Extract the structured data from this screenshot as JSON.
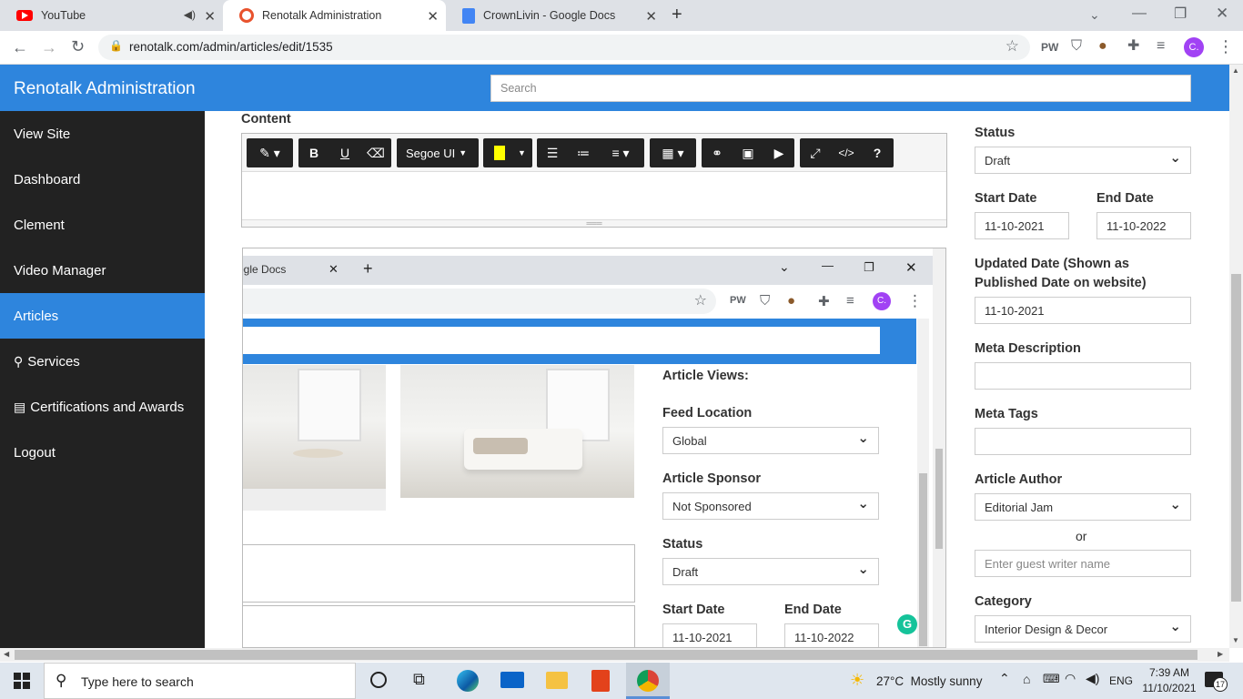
{
  "browser": {
    "tabs": [
      {
        "title": "YouTube",
        "color": "#ff0000"
      },
      {
        "title": "Renotalk Administration",
        "color": "#e8522d"
      },
      {
        "title": "CrownLivin - Google Docs",
        "color": "#4285f4"
      }
    ],
    "url": "renotalk.com/admin/articles/edit/1535"
  },
  "app": {
    "title": "Renotalk Administration",
    "search_placeholder": "Search",
    "accent": "#2e85dd"
  },
  "sidebar": {
    "items": [
      {
        "label": "View Site"
      },
      {
        "label": "Dashboard"
      },
      {
        "label": "Clement"
      },
      {
        "label": "Video Manager"
      },
      {
        "label": "Articles"
      },
      {
        "label": "Services"
      },
      {
        "label": "Certifications and Awards"
      },
      {
        "label": "Logout"
      }
    ]
  },
  "editor": {
    "content_label": "Content",
    "font": "Segoe UI"
  },
  "right": {
    "status_label": "Status",
    "status_value": "Draft",
    "start_date_label": "Start Date",
    "start_date_value": "11-10-2021",
    "end_date_label": "End Date",
    "end_date_value": "11-10-2022",
    "updated_label_1": "Updated Date (Shown as",
    "updated_label_2": "Published Date on website)",
    "updated_value": "11-10-2021",
    "meta_desc_label": "Meta Description",
    "meta_tags_label": "Meta Tags",
    "author_label": "Article Author",
    "author_value": "Editorial Jam",
    "or_text": "or",
    "guest_placeholder": "Enter guest writer name",
    "category_label": "Category",
    "category_value": "Interior Design & Decor"
  },
  "nested": {
    "tab_text": "ogle Docs",
    "article_views_label": "Article Views:",
    "feed_location_label": "Feed Location",
    "feed_location_value": "Global",
    "sponsor_label": "Article Sponsor",
    "sponsor_value": "Not Sponsored",
    "status_label": "Status",
    "status_value": "Draft",
    "start_date_label": "Start Date",
    "end_date_label": "End Date",
    "start_date_value": "11-10-2021",
    "end_date_value": "11-10-2022"
  },
  "taskbar": {
    "search_text": "Type here to search",
    "weather": "27°C  Mostly sunny",
    "lang": "ENG",
    "time": "7:39 AM",
    "date": "11/10/2021",
    "notif_count": "17"
  }
}
